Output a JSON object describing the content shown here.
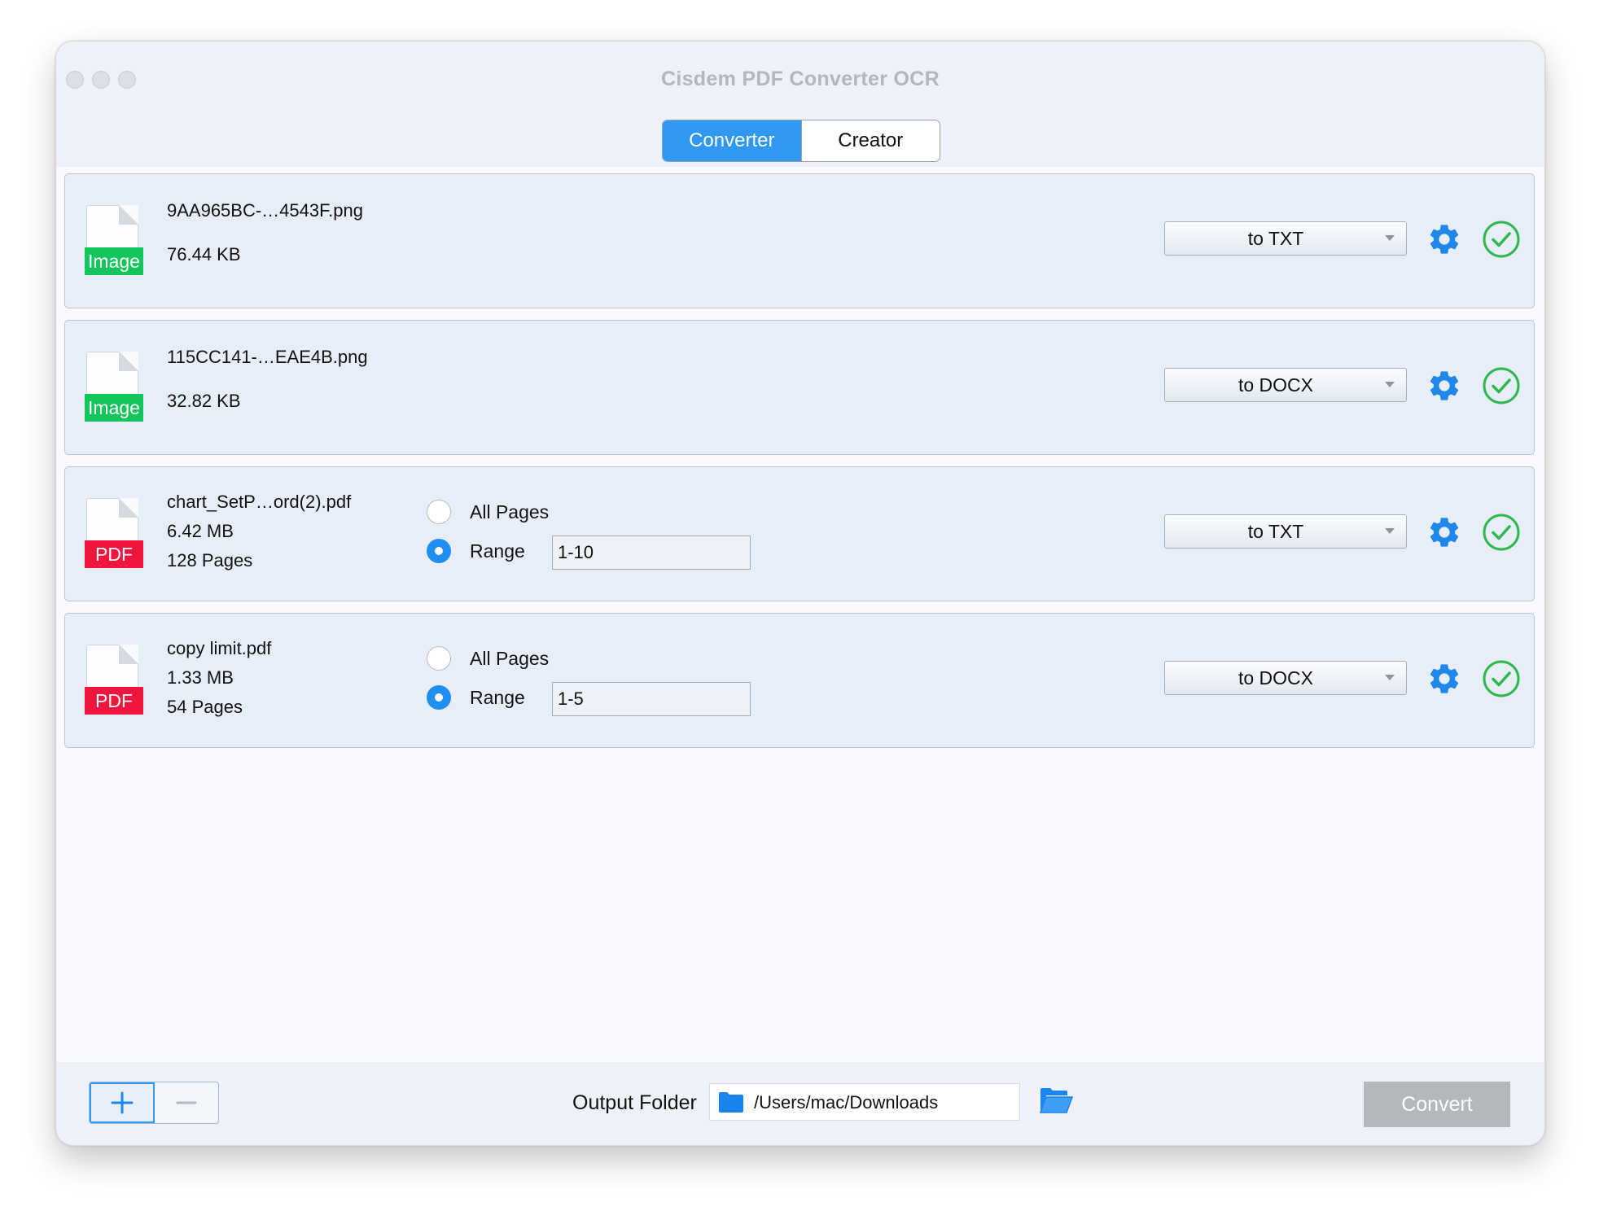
{
  "window": {
    "title": "Cisdem PDF Converter OCR"
  },
  "tabs": [
    {
      "label": "Converter",
      "active": true
    },
    {
      "label": "Creator",
      "active": false
    }
  ],
  "files": [
    {
      "name": "9AA965BC-…4543F.png",
      "size": "76.44 KB",
      "type": "Image",
      "format": "to TXT",
      "icon": "image-file-icon"
    },
    {
      "name": "115CC141-…EAE4B.png",
      "size": "32.82 KB",
      "type": "Image",
      "format": "to DOCX",
      "icon": "image-file-icon"
    },
    {
      "name": "chart_SetP…ord(2).pdf",
      "size": "6.42 MB",
      "pages": "128 Pages",
      "type": "PDF",
      "format": "to TXT",
      "all_pages_label": "All Pages",
      "range_label": "Range",
      "range": "1-10",
      "selected": "range",
      "icon": "pdf-file-icon"
    },
    {
      "name": "copy limit.pdf",
      "size": "1.33 MB",
      "pages": "54 Pages",
      "type": "PDF",
      "format": "to DOCX",
      "all_pages_label": "All Pages",
      "range_label": "Range",
      "range": "1-5",
      "selected": "range",
      "icon": "pdf-file-icon"
    }
  ],
  "footer": {
    "output_label": "Output Folder",
    "output_path": "/Users/mac/Downloads",
    "convert_label": "Convert",
    "add_icon": "plus-icon",
    "remove_icon": "minus-icon"
  },
  "colors": {
    "accent": "#2f98f0",
    "image_badge": "#13c55a",
    "pdf_badge": "#f0153d",
    "check": "#2db84d",
    "convert_disabled": "#b4b7bc"
  }
}
